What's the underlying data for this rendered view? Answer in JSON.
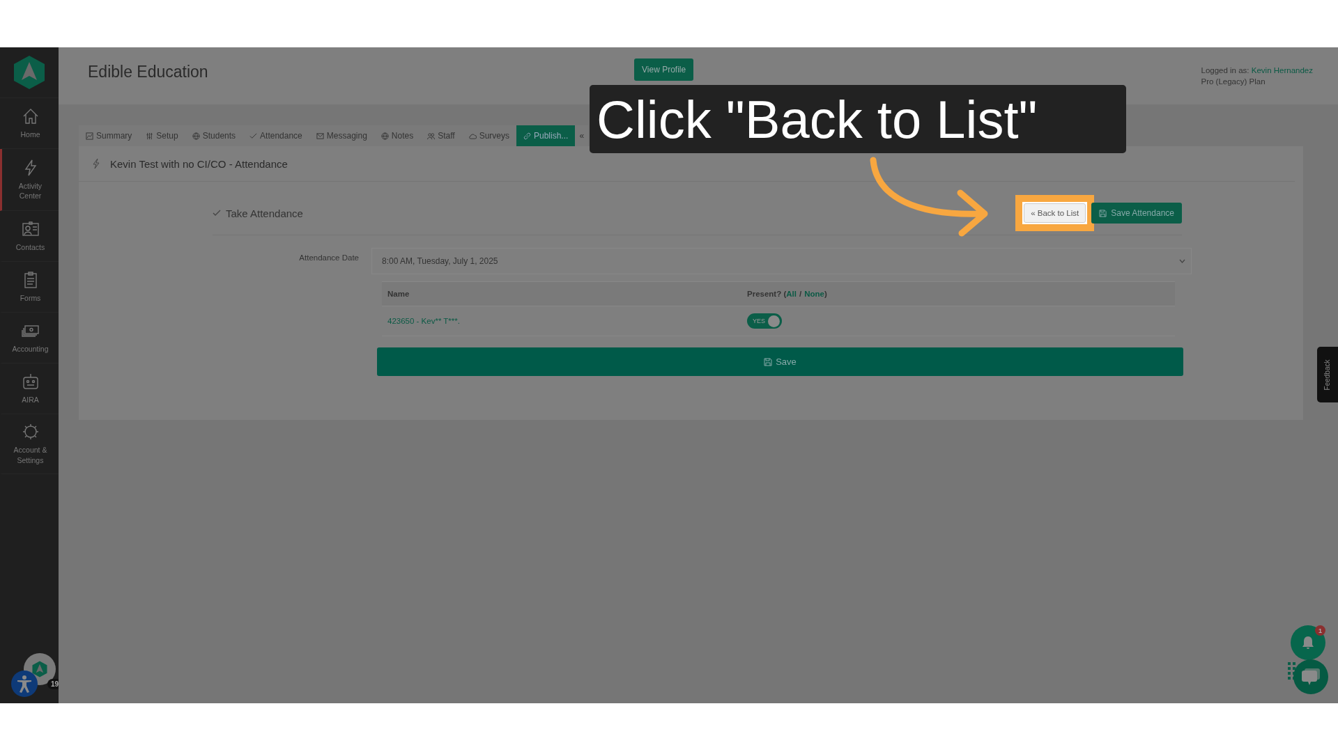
{
  "sidebar": {
    "items": [
      {
        "label": "Home",
        "selected": false
      },
      {
        "label": "Activity Center",
        "selected": true
      },
      {
        "label": "Contacts",
        "selected": false
      },
      {
        "label": "Forms",
        "selected": false
      },
      {
        "label": "Accounting",
        "selected": false
      },
      {
        "label": "AIRA",
        "selected": false
      },
      {
        "label": "Account & Settings",
        "selected": false
      }
    ],
    "badge": "19"
  },
  "header": {
    "title": "Edible Education",
    "view_profile": "View Profile",
    "logged_in_label": "Logged in as:",
    "user": "Kevin Hernandez",
    "plan": "Pro (Legacy) Plan"
  },
  "tabs": [
    {
      "label": "Summary",
      "selected": false
    },
    {
      "label": "Setup",
      "selected": false
    },
    {
      "label": "Students",
      "selected": false
    },
    {
      "label": "Attendance",
      "selected": false
    },
    {
      "label": "Messaging",
      "selected": false
    },
    {
      "label": "Notes",
      "selected": false
    },
    {
      "label": "Staff",
      "selected": false
    },
    {
      "label": "Surveys",
      "selected": false
    },
    {
      "label": "Publish...",
      "selected": true
    },
    {
      "label": "«",
      "selected": false
    }
  ],
  "page_title": "Kevin Test with no CI/CO - Attendance",
  "section": {
    "title": "Take Attendance",
    "back_button": "« Back to List",
    "save_attendance_button": "Save Attendance"
  },
  "attendance_date": {
    "label": "Attendance Date",
    "value": "8:00 AM, Tuesday, July 1, 2025"
  },
  "table": {
    "columns": [
      "Name",
      "Present? ("
    ],
    "all_link": "All",
    "separator": "/",
    "none_link": "None",
    "close": ")",
    "rows": [
      {
        "name": "423650 - Kev** T***.",
        "present": true,
        "toggle_label": "YES"
      }
    ]
  },
  "save_button": "Save",
  "feedback": "Feedback",
  "notifications": {
    "count": "1"
  },
  "callout": "Click \"Back to List\""
}
